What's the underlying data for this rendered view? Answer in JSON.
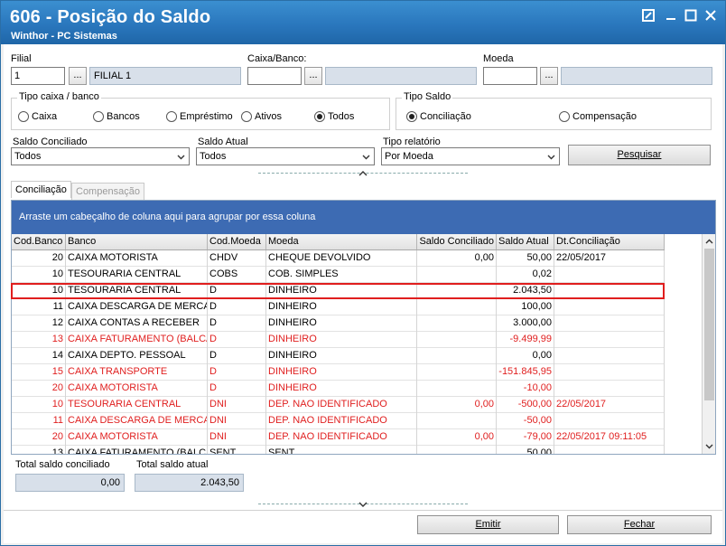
{
  "window": {
    "title": "606 - Posição do Saldo",
    "subtitle": "Winthor - PC Sistemas"
  },
  "filters": {
    "filial_label": "Filial",
    "filial_code": "1",
    "filial_name": "FILIAL 1",
    "caixa_label": "Caixa/Banco:",
    "caixa_code": "",
    "caixa_name": "",
    "moeda_label": "Moeda",
    "moeda_code": "",
    "moeda_name": "",
    "lookup_button": "...",
    "tipo_caixa_title": "Tipo caixa / banco",
    "tipo_caixa_options": [
      "Caixa",
      "Bancos",
      "Empréstimo",
      "Ativos",
      "Todos"
    ],
    "tipo_caixa_selected": "Todos",
    "tipo_saldo_title": "Tipo Saldo",
    "tipo_saldo_options": [
      "Conciliação",
      "Compensação"
    ],
    "tipo_saldo_selected": "Conciliação",
    "saldo_conciliado_label": "Saldo Conciliado",
    "saldo_conciliado_value": "Todos",
    "saldo_atual_label": "Saldo Atual",
    "saldo_atual_value": "Todos",
    "tipo_relatorio_label": "Tipo relatório",
    "tipo_relatorio_value": "Por Moeda",
    "pesquisar_button": "Pesquisar"
  },
  "tabs": [
    {
      "label": "Conciliação",
      "active": true
    },
    {
      "label": "Compensação",
      "active": false
    }
  ],
  "grid": {
    "group_hint": "Arraste um cabeçalho de coluna aqui para agrupar por essa coluna",
    "columns": [
      "Cod.Banco",
      "Banco",
      "Cod.Moeda",
      "Moeda",
      "Saldo Conciliado",
      "Saldo Atual",
      "Dt.Conciliação"
    ],
    "rows": [
      {
        "cod": "20",
        "banco": "CAIXA MOTORISTA",
        "codmoeda": "CHDV",
        "moeda": "CHEQUE DEVOLVIDO",
        "conc": "0,00",
        "atual": "50,00",
        "dt": "22/05/2017",
        "red": false
      },
      {
        "cod": "10",
        "banco": "TESOURARIA CENTRAL",
        "codmoeda": "COBS",
        "moeda": "COB. SIMPLES",
        "conc": "",
        "atual": "0,02",
        "dt": "",
        "red": false
      },
      {
        "cod": "10",
        "banco": "TESOURARIA CENTRAL",
        "codmoeda": "D",
        "moeda": "DINHEIRO",
        "conc": "",
        "atual": "2.043,50",
        "dt": "",
        "red": false
      },
      {
        "cod": "11",
        "banco": "CAIXA DESCARGA DE MERCADORIAS",
        "codmoeda": "D",
        "moeda": "DINHEIRO",
        "conc": "",
        "atual": "100,00",
        "dt": "",
        "red": false
      },
      {
        "cod": "12",
        "banco": "CAIXA CONTAS A RECEBER",
        "codmoeda": "D",
        "moeda": "DINHEIRO",
        "conc": "",
        "atual": "3.000,00",
        "dt": "",
        "red": false
      },
      {
        "cod": "13",
        "banco": "CAIXA FATURAMENTO (BALCÃO)",
        "codmoeda": "D",
        "moeda": "DINHEIRO",
        "conc": "",
        "atual": "-9.499,99",
        "dt": "",
        "red": true
      },
      {
        "cod": "14",
        "banco": "CAIXA DEPTO. PESSOAL",
        "codmoeda": "D",
        "moeda": "DINHEIRO",
        "conc": "",
        "atual": "0,00",
        "dt": "",
        "red": false
      },
      {
        "cod": "15",
        "banco": "CAIXA TRANSPORTE",
        "codmoeda": "D",
        "moeda": "DINHEIRO",
        "conc": "",
        "atual": "-151.845,95",
        "dt": "",
        "red": true
      },
      {
        "cod": "20",
        "banco": "CAIXA MOTORISTA",
        "codmoeda": "D",
        "moeda": "DINHEIRO",
        "conc": "",
        "atual": "-10,00",
        "dt": "",
        "red": true
      },
      {
        "cod": "10",
        "banco": "TESOURARIA CENTRAL",
        "codmoeda": "DNI",
        "moeda": "DEP. NAO IDENTIFICADO",
        "conc": "0,00",
        "atual": "-500,00",
        "dt": "22/05/2017",
        "red": true
      },
      {
        "cod": "11",
        "banco": "CAIXA DESCARGA DE MERCADORIAS",
        "codmoeda": "DNI",
        "moeda": "DEP. NAO IDENTIFICADO",
        "conc": "",
        "atual": "-50,00",
        "dt": "",
        "red": true
      },
      {
        "cod": "20",
        "banco": "CAIXA MOTORISTA",
        "codmoeda": "DNI",
        "moeda": "DEP. NAO IDENTIFICADO",
        "conc": "0,00",
        "atual": "-79,00",
        "dt": "22/05/2017 09:11:05",
        "red": true
      },
      {
        "cod": "13",
        "banco": "CAIXA FATURAMENTO (BALCÃO)",
        "codmoeda": "SENT",
        "moeda": "SENT",
        "conc": "",
        "atual": "50,00",
        "dt": "",
        "red": false
      }
    ]
  },
  "totals": {
    "conciliado_label": "Total saldo conciliado",
    "conciliado_value": "0,00",
    "atual_label": "Total saldo atual",
    "atual_value": "2.043,50"
  },
  "actions": {
    "emitir": "Emitir",
    "fechar": "Fechar"
  }
}
